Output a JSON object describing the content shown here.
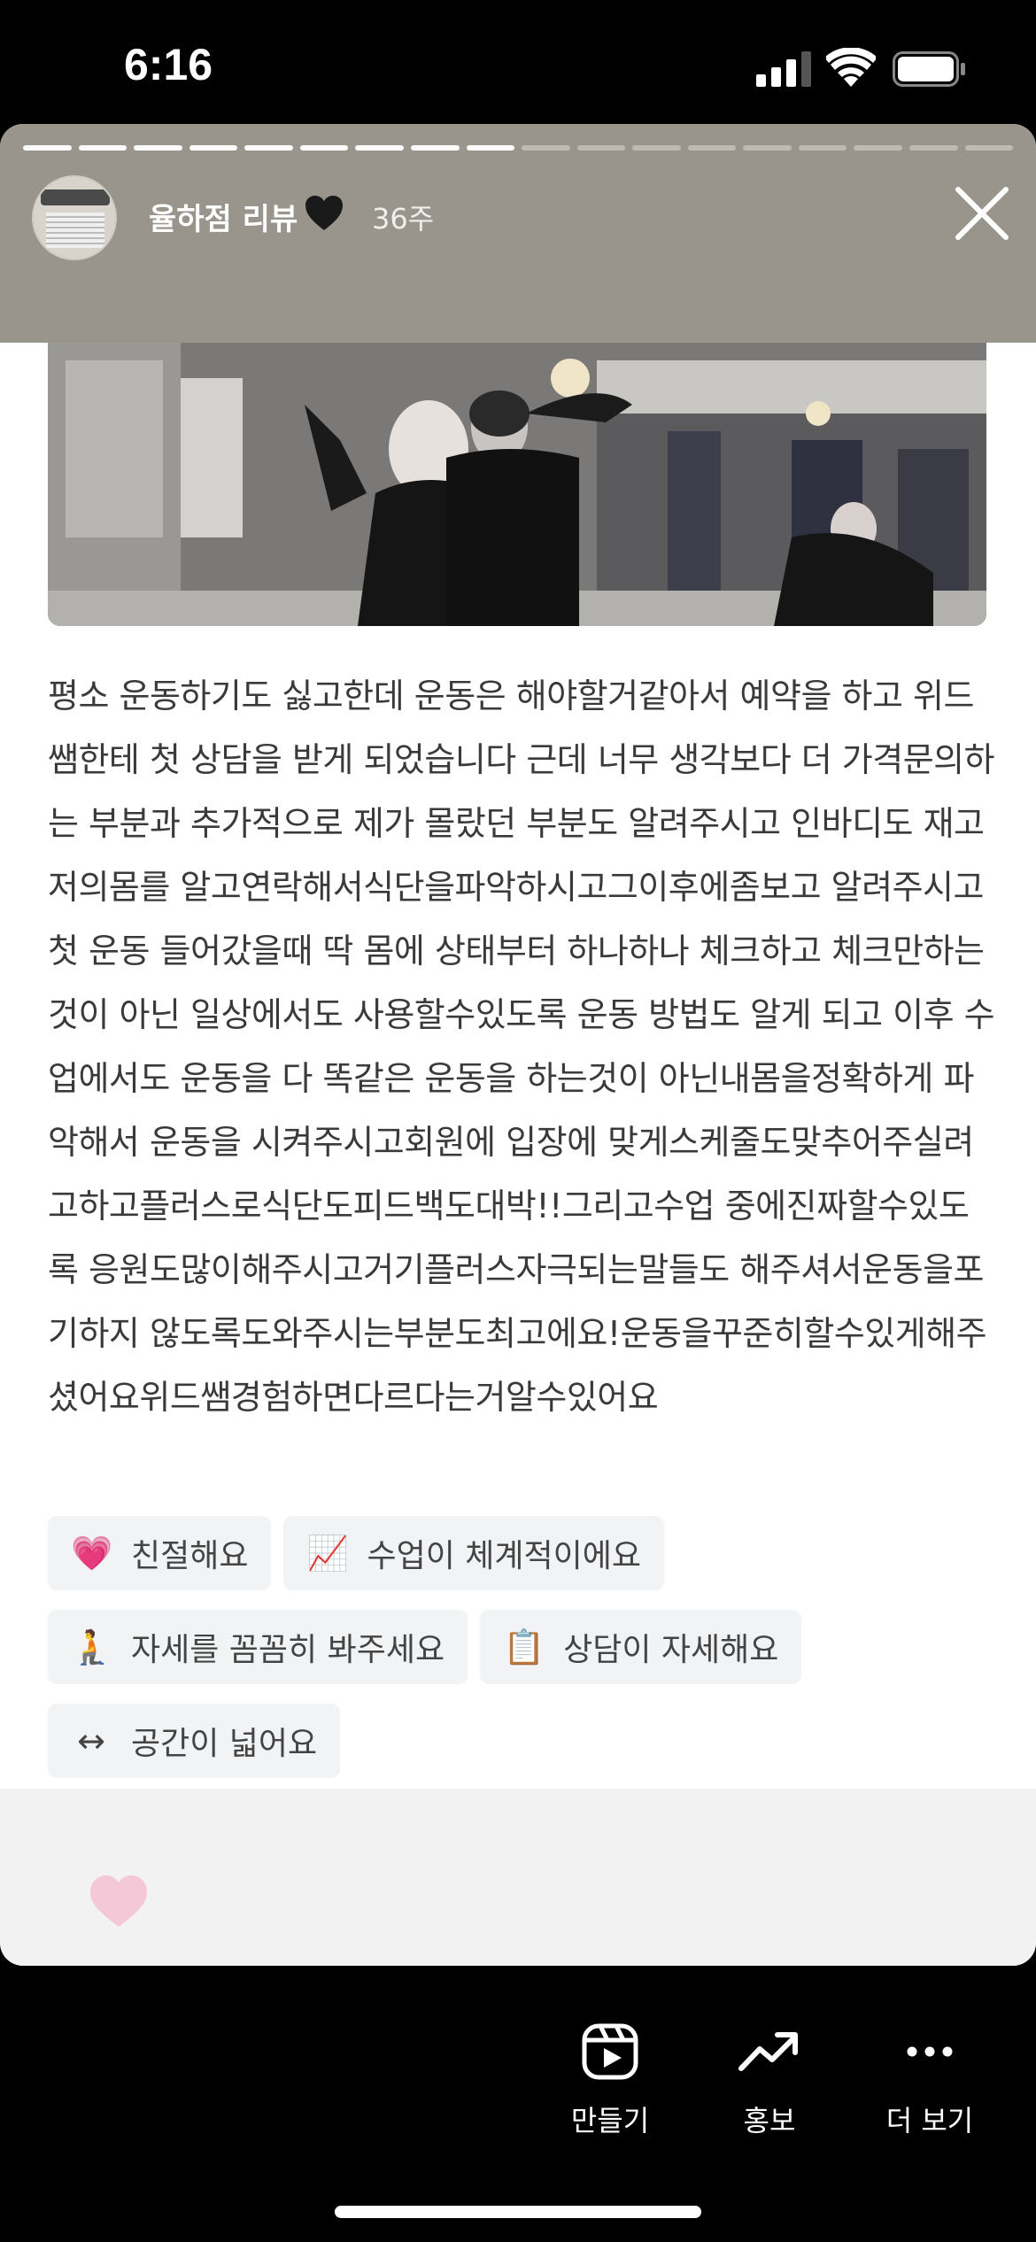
{
  "status_bar": {
    "time": "6:16",
    "icons": [
      "cellular-signal-icon",
      "wifi-icon",
      "battery-icon"
    ]
  },
  "story": {
    "progress_segments_total": 18,
    "progress_segments_completed": 9,
    "username": "율하점 리뷰",
    "username_emoji": "black-heart-icon",
    "age": "36주",
    "close_icon": "close-icon"
  },
  "review": {
    "text": "평소 운동하기도 싫고한데 운동은 해야할거같아서 예약을 하고 위드쌤한테 첫 상담을 받게 되었습니다 근데 너무 생각보다 더 가격문의하는 부분과 추가적으로 제가 몰랐던 부분도 알려주시고 인바디도 재고 저의몸를 알고연락해서식단을파악하시고그이후에좀보고 알려주시고 첫 운동 들어갔을때 딱 몸에 상태부터 하나하나 체크하고 체크만하는 것이 아닌 일상에서도 사용할수있도록 운동 방법도 알게 되고 이후 수업에서도 운동을 다 똑같은 운동을 하는것이 아닌내몸을정확하게 파악해서 운동을 시켜주시고회원에 입장에 맞게스케줄도맞추어주실려고하고플러스로식단도피드백도대박!!그리고수업 중에진짜할수있도록 응원도많이해주시고거기플러스자극되는말들도 해주셔서운동을포기하지 않도록도와주시는부분도최고에요!운동을꾸준히할수있게해주셨어요위드쌤경험하면다르다는거알수있어요",
    "tags": [
      {
        "emoji": "💗",
        "label": "친절해요"
      },
      {
        "emoji": "📈",
        "label": "수업이 체계적이에요"
      },
      {
        "emoji": "🧎",
        "label": "자세를 꼼꼼히 봐주세요"
      },
      {
        "emoji": "📋",
        "label": "상담이 자세해요"
      },
      {
        "emoji": "↔",
        "label": "공간이 넓어요"
      }
    ]
  },
  "bottom_actions": [
    {
      "icon": "reels-create-icon",
      "label": "만들기"
    },
    {
      "icon": "trending-up-icon",
      "label": "홍보"
    },
    {
      "icon": "more-dots-icon",
      "label": "더 보기"
    }
  ],
  "colors": {
    "header_bg": "#9a958c",
    "text": "#3a3a3a",
    "tag_bg": "#f2f3f5",
    "like_heart": "#f7a6c0"
  }
}
